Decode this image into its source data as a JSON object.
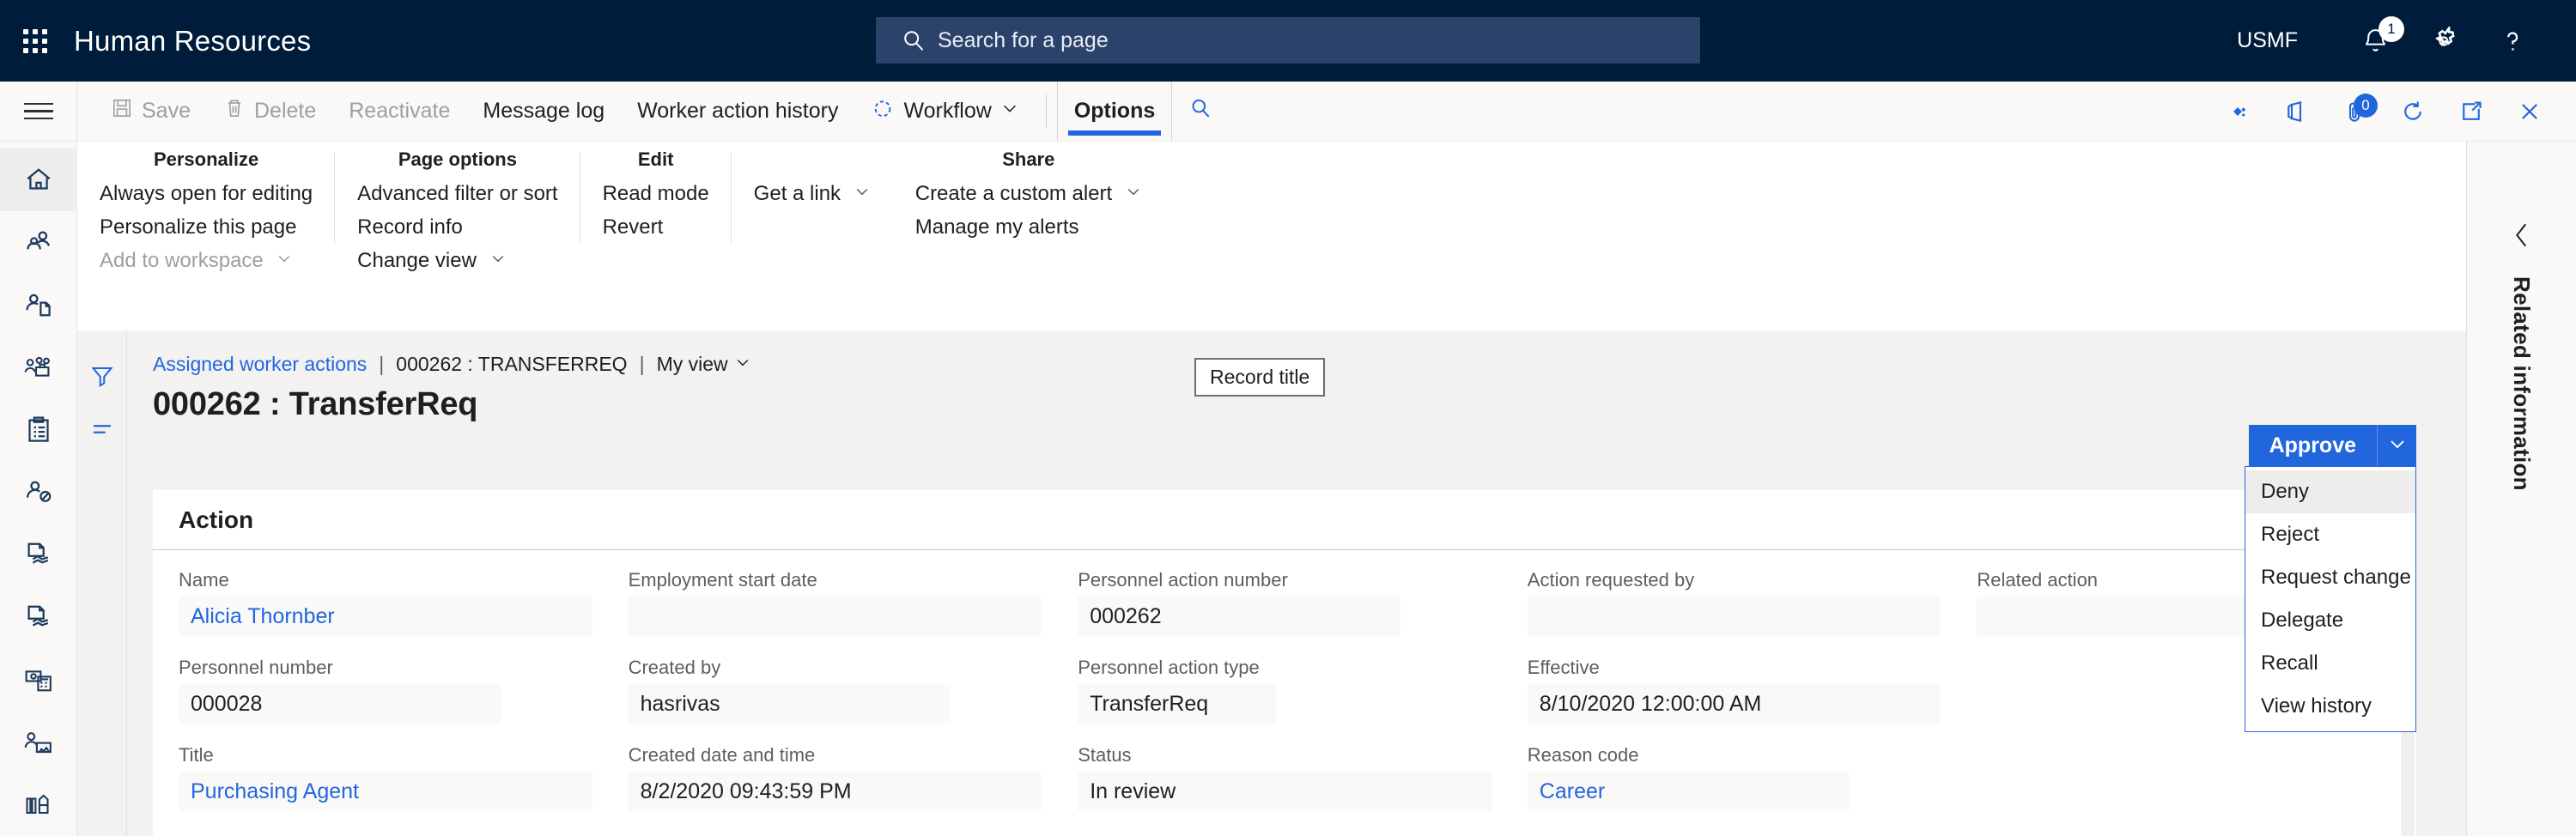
{
  "header": {
    "app_title": "Human Resources",
    "waffle_icon": "app-launcher-icon",
    "search": {
      "placeholder": "Search for a page",
      "icon": "search-icon"
    },
    "company": "USMF",
    "icons": [
      {
        "name": "notifications-icon",
        "badge": "1"
      },
      {
        "name": "settings-gear-icon",
        "badge": ""
      },
      {
        "name": "help-question-icon",
        "badge": ""
      }
    ]
  },
  "command_bar": {
    "hamburger_icon": "hamburger-menu-icon",
    "items": [
      {
        "label": "Save",
        "icon": "save-disk-icon",
        "disabled": true
      },
      {
        "label": "Delete",
        "icon": "trash-icon",
        "disabled": true
      },
      {
        "label": "Reactivate",
        "icon": "",
        "disabled": true
      },
      {
        "label": "Message log",
        "icon": "",
        "disabled": false
      },
      {
        "label": "Worker action history",
        "icon": "",
        "disabled": false
      },
      {
        "label": "Workflow",
        "icon": "workflow-circle-icon",
        "disabled": false,
        "caret": true
      }
    ],
    "active_tab": "Options",
    "search_icon": "search-icon",
    "right_icons": [
      {
        "name": "dynamics-diamond-icon",
        "badge": ""
      },
      {
        "name": "office-apps-icon",
        "badge": ""
      },
      {
        "name": "attachments-icon",
        "badge": "0"
      },
      {
        "name": "refresh-icon",
        "badge": ""
      },
      {
        "name": "open-in-new-window-icon",
        "badge": ""
      },
      {
        "name": "close-icon",
        "badge": ""
      }
    ]
  },
  "options_panel": {
    "collapse_icon": "chevron-up-icon",
    "groups": [
      {
        "heading": "Personalize",
        "items": [
          {
            "label": "Always open for editing",
            "disabled": false,
            "caret": false
          },
          {
            "label": "Personalize this page",
            "disabled": false,
            "caret": false
          },
          {
            "label": "Add to workspace",
            "disabled": true,
            "caret": true
          }
        ]
      },
      {
        "heading": "Page options",
        "items": [
          {
            "label": "Advanced filter or sort",
            "disabled": false,
            "caret": false
          },
          {
            "label": "Record info",
            "disabled": false,
            "caret": false
          },
          {
            "label": "Change view",
            "disabled": false,
            "caret": true
          }
        ]
      },
      {
        "heading": "Edit",
        "items": [
          {
            "label": "Read mode",
            "disabled": false,
            "caret": false
          },
          {
            "label": "Revert",
            "disabled": false,
            "caret": false
          }
        ]
      },
      {
        "heading": "",
        "items": [
          {
            "label": "Get a link",
            "disabled": false,
            "caret": true
          }
        ]
      },
      {
        "heading": "Share",
        "items": [
          {
            "label": "Create a custom alert",
            "disabled": false,
            "caret": true
          },
          {
            "label": "Manage my alerts",
            "disabled": false,
            "caret": false
          }
        ]
      }
    ]
  },
  "nav_rail": {
    "items": [
      {
        "name": "home-icon",
        "selected": true
      },
      {
        "name": "people-group-icon",
        "selected": false
      },
      {
        "name": "person-document-icon",
        "selected": false
      },
      {
        "name": "workforce-team-icon",
        "selected": false
      },
      {
        "name": "clipboard-checklist-icon",
        "selected": false
      },
      {
        "name": "person-blocked-icon",
        "selected": false
      },
      {
        "name": "document-handshake-icon",
        "selected": false
      },
      {
        "name": "document-handshake-alt-icon",
        "selected": false
      },
      {
        "name": "payroll-calculator-icon",
        "selected": false
      },
      {
        "name": "person-training-icon",
        "selected": false
      },
      {
        "name": "reports-bars-icon",
        "selected": false
      }
    ]
  },
  "page": {
    "filter_icon": "filter-funnel-icon",
    "list_icon": "list-lines-icon",
    "breadcrumb": {
      "link": "Assigned worker actions",
      "separator": "|",
      "record": "000262 : TRANSFERREQ",
      "view_label": "My view",
      "view_caret_icon": "chevron-down-icon"
    },
    "title": "000262 : TransferReq",
    "tooltip": "Record title",
    "primary_button": {
      "label": "Approve",
      "caret_icon": "chevron-down-icon",
      "color": "#2266dd"
    },
    "dropdown": {
      "items": [
        {
          "label": "Deny",
          "hover": true
        },
        {
          "label": "Reject",
          "hover": false
        },
        {
          "label": "Request change",
          "hover": false
        },
        {
          "label": "Delegate",
          "hover": false
        },
        {
          "label": "Recall",
          "hover": false
        },
        {
          "label": "View history",
          "hover": false
        }
      ]
    },
    "card": {
      "title": "Action",
      "date": "8/10/2020 12:0",
      "columns": [
        {
          "fields": [
            {
              "label": "Name",
              "value": "Alicia Thornber",
              "link": true,
              "width": "full"
            },
            {
              "label": "Personnel number",
              "value": "000028",
              "link": false,
              "width": "short"
            },
            {
              "label": "Title",
              "value": "Purchasing Agent",
              "link": true,
              "width": "full"
            }
          ]
        },
        {
          "fields": [
            {
              "label": "Employment start date",
              "value": "",
              "link": false,
              "width": "full"
            },
            {
              "label": "Created by",
              "value": "hasrivas",
              "link": false,
              "width": "short"
            },
            {
              "label": "Created date and time",
              "value": "8/2/2020 09:43:59 PM",
              "link": false,
              "width": "full"
            }
          ]
        },
        {
          "fields": [
            {
              "label": "Personnel action number",
              "value": "000262",
              "link": false,
              "width": "short"
            },
            {
              "label": "Personnel action type",
              "value": "TransferReq",
              "link": false,
              "width": "xs"
            },
            {
              "label": "Status",
              "value": "In review",
              "link": false,
              "width": "full"
            }
          ]
        },
        {
          "fields": [
            {
              "label": "Action requested by",
              "value": "",
              "link": false,
              "width": "full"
            },
            {
              "label": "Effective",
              "value": "8/10/2020 12:00:00 AM",
              "link": false,
              "width": "full"
            },
            {
              "label": "Reason code",
              "value": "Career",
              "link": true,
              "width": "short"
            }
          ]
        },
        {
          "fields": [
            {
              "label": "Related action",
              "value": "",
              "link": false,
              "width": "short"
            }
          ]
        }
      ]
    }
  },
  "related_panel": {
    "collapse_icon": "chevron-left-icon",
    "title": "Related information"
  }
}
